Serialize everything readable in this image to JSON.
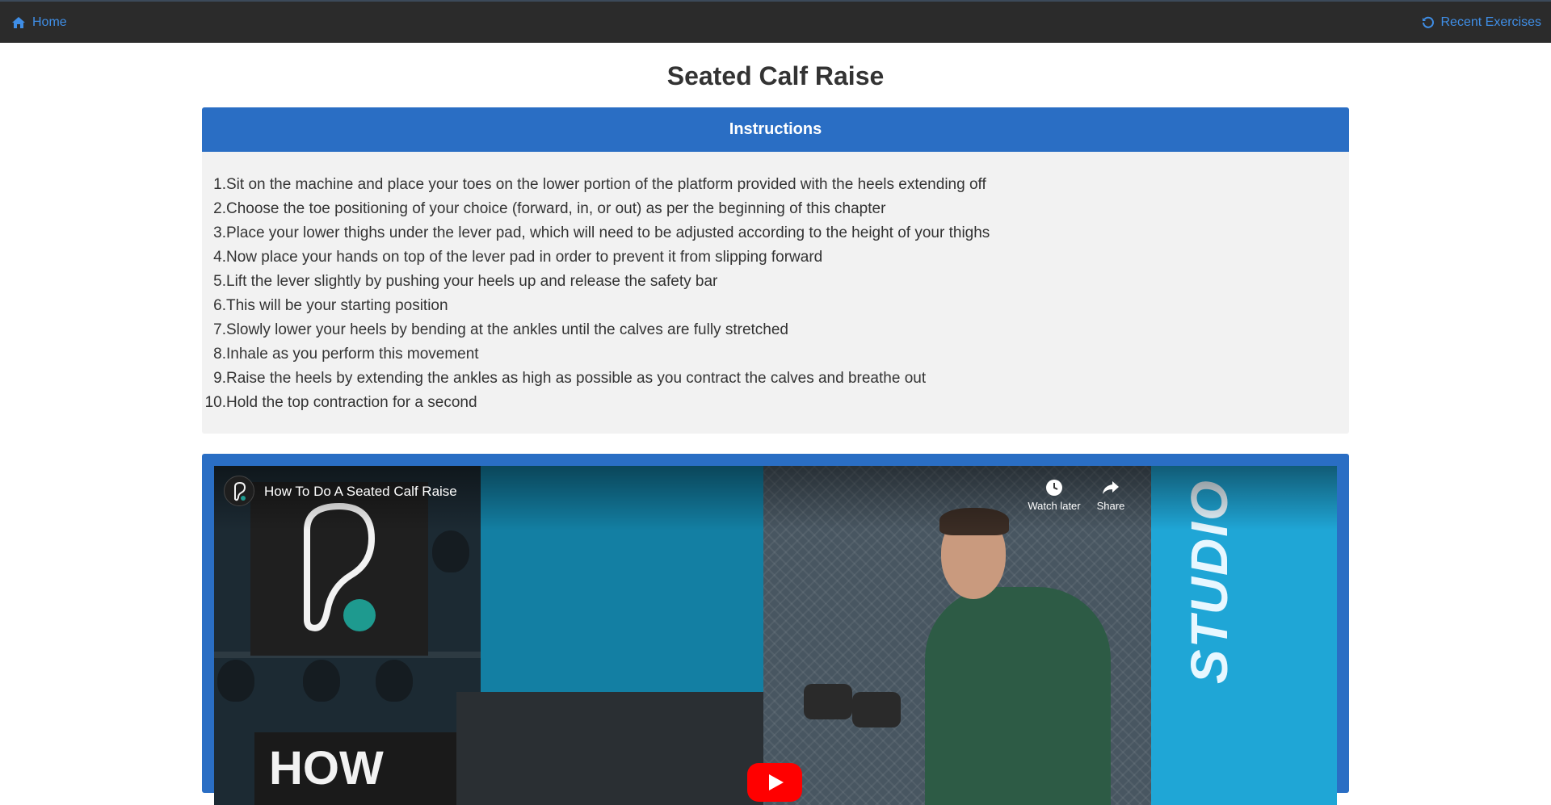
{
  "nav": {
    "home_label": "Home",
    "recent_label": "Recent Exercises",
    "home_icon": "home-icon",
    "recent_icon": "history-icon"
  },
  "page": {
    "title": "Seated Calf Raise"
  },
  "instructions": {
    "header": "Instructions",
    "steps": [
      {
        "num": "1.",
        "text": "Sit on the machine and place your toes on the lower portion of the platform provided with the heels extending off"
      },
      {
        "num": "2.",
        "text": "Choose the toe positioning of your choice (forward, in, or out) as per the beginning of this chapter"
      },
      {
        "num": "3.",
        "text": "Place your lower thighs under the lever pad, which will need to be adjusted according to the height of your thighs"
      },
      {
        "num": "4.",
        "text": "Now place your hands on top of the lever pad in order to prevent it from slipping forward"
      },
      {
        "num": "5.",
        "text": "Lift the lever slightly by pushing your heels up and release the safety bar"
      },
      {
        "num": "6.",
        "text": "This will be your starting position"
      },
      {
        "num": "7.",
        "text": "Slowly lower your heels by bending at the ankles until the calves are fully stretched"
      },
      {
        "num": "8.",
        "text": "Inhale as you perform this movement"
      },
      {
        "num": "9.",
        "text": "Raise the heels by extending the ankles as high as possible as you contract the calves and breathe out"
      },
      {
        "num": "10.",
        "text": "Hold the top contraction for a second"
      }
    ]
  },
  "video": {
    "title": "How To Do A Seated Calf Raise",
    "watch_later_label": "Watch later",
    "share_label": "Share",
    "thumbnail_text": "HOW TO",
    "wall_text": "STUDIO"
  },
  "colors": {
    "navbar_bg": "#2b2b2b",
    "link": "#3f8ee6",
    "card_header": "#2a6ec4",
    "card_body": "#f2f2f2"
  }
}
